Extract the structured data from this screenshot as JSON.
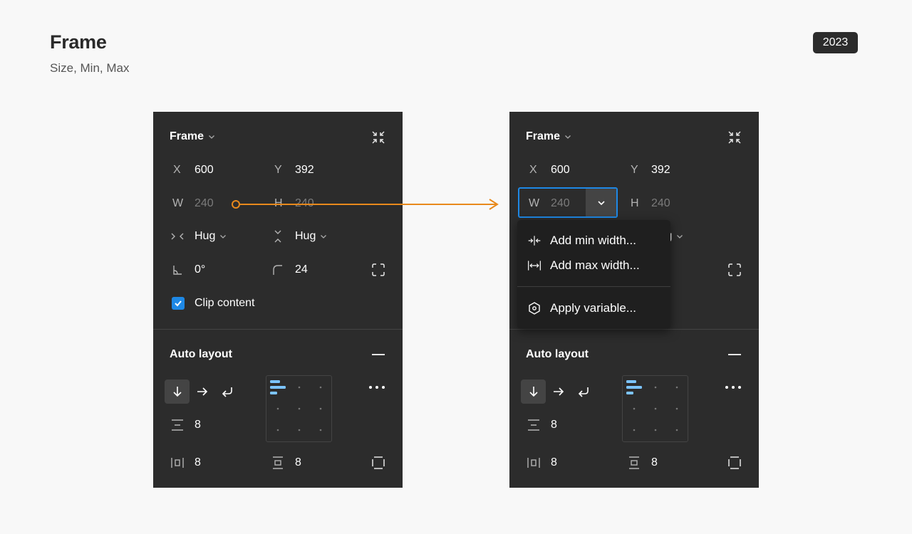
{
  "page": {
    "title": "Frame",
    "subtitle": "Size, Min, Max",
    "year": "2023"
  },
  "colors": {
    "accent": "#1e88e5",
    "connector": "#e8891c",
    "panel_bg": "#2c2c2c",
    "menu_bg": "#1f1f1f"
  },
  "panel": {
    "header": "Frame",
    "x_label": "X",
    "x_value": "600",
    "y_label": "Y",
    "y_value": "392",
    "w_label": "W",
    "w_value": "240",
    "h_label": "H",
    "h_value": "240",
    "horizontal_resizing": "Hug",
    "vertical_resizing": "Hug",
    "rotation": "0°",
    "corner_radius": "24",
    "clip_content_label": "Clip content",
    "clip_content_checked": true,
    "auto_layout_title": "Auto layout",
    "gap": "8",
    "horizontal_padding": "8",
    "vertical_padding": "8",
    "icons": [
      "chevron-down-icon",
      "collapse-icon",
      "resize-horizontal-icon",
      "resize-vertical-icon",
      "rotation-icon",
      "corner-radius-icon",
      "independent-corners-icon",
      "arrow-down-icon",
      "arrow-right-icon",
      "wrap-icon",
      "more-icon",
      "spacing-icon",
      "padding-horizontal-icon",
      "padding-vertical-icon",
      "padding-individual-icon"
    ]
  },
  "dropdown": {
    "items": [
      {
        "label": "Add min width...",
        "icon": "min-width-icon"
      },
      {
        "label": "Add max width...",
        "icon": "max-width-icon"
      },
      {
        "label": "Apply variable...",
        "icon": "variable-icon"
      }
    ]
  }
}
